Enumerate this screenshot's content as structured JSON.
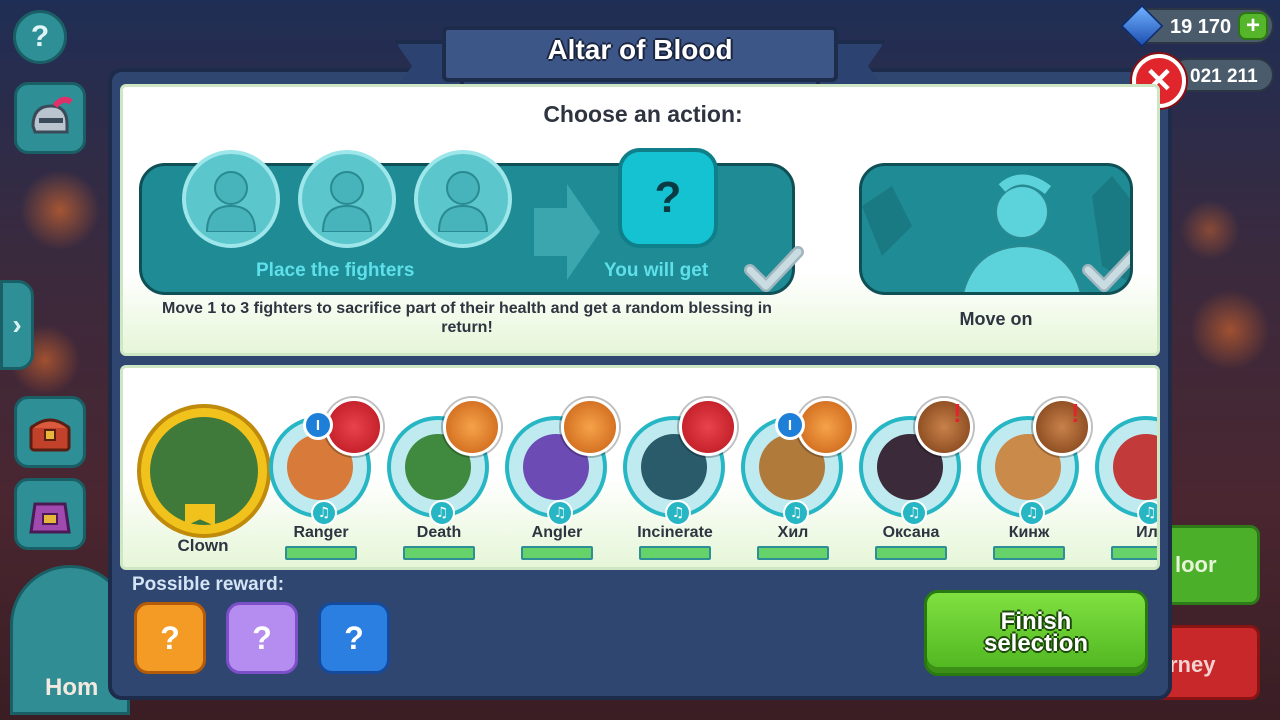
{
  "hud": {
    "help": "?",
    "gems": "19 170",
    "gold": "021 211",
    "castle_label": "Hom",
    "bg_button_green": "loor",
    "bg_button_red": "rney"
  },
  "dialog": {
    "title": "Altar of Blood",
    "subtitle": "Choose an action:",
    "place_label": "Place the fighters",
    "get_label": "You will get",
    "description": "Move 1 to 3 fighters to sacrifice part of their health and get a random blessing in return!",
    "move_on": "Move on",
    "possible_reward": "Possible reward:",
    "finish_button": "Finish selection"
  },
  "hero": {
    "name": "Clown"
  },
  "fighters": [
    {
      "name": "Ranger",
      "rank": "I",
      "skill_color": "red",
      "alert": false,
      "face": "#d77a3a"
    },
    {
      "name": "Death",
      "rank": "",
      "skill_color": "orange",
      "alert": false,
      "face": "#3f8a3f"
    },
    {
      "name": "Angler",
      "rank": "",
      "skill_color": "orange",
      "alert": false,
      "face": "#6c4bb4"
    },
    {
      "name": "Incinerate",
      "rank": "",
      "skill_color": "red",
      "alert": false,
      "face": "#2a5b6a"
    },
    {
      "name": "Хил",
      "rank": "I",
      "skill_color": "orange",
      "alert": false,
      "face": "#b07a3a"
    },
    {
      "name": "Оксана",
      "rank": "",
      "skill_color": "brown",
      "alert": true,
      "face": "#3a2a3a"
    },
    {
      "name": "Кинж",
      "rank": "",
      "skill_color": "brown",
      "alert": true,
      "face": "#c98a4a"
    },
    {
      "name": "Ил",
      "rank": "",
      "skill_color": "",
      "alert": false,
      "face": "#c33a3a"
    }
  ],
  "rewards": [
    {
      "icon": "orange-mystery-blessing-icon",
      "glyph": "?"
    },
    {
      "icon": "purple-mystery-blessing-icon",
      "glyph": "?"
    },
    {
      "icon": "blue-mystery-blessing-icon",
      "glyph": "?"
    }
  ],
  "colors": {
    "panel": "#2e4670",
    "teal": "#1f8b95",
    "finish_green": "#4fb520",
    "close_red": "#e0262c"
  }
}
